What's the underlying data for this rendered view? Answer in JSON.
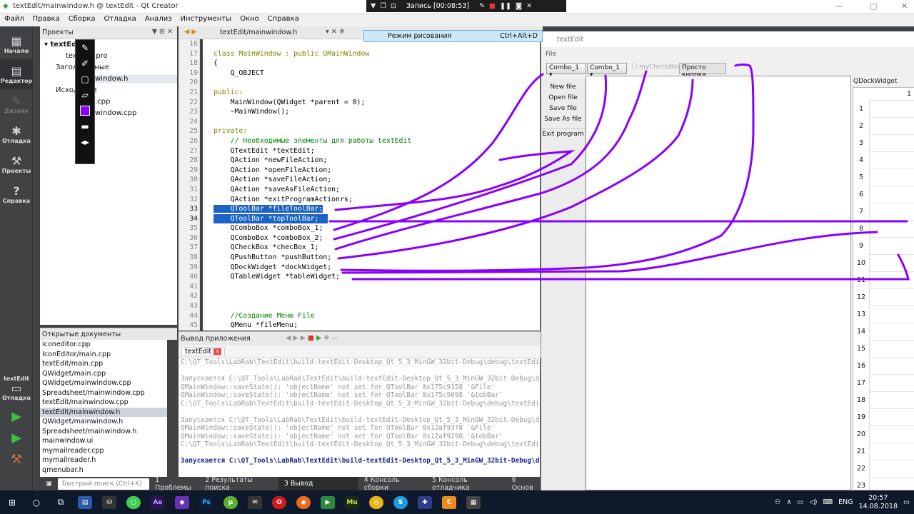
{
  "window": {
    "title": "textEdit/mainwindow.h @ textEdit - Qt Creator"
  },
  "menu": [
    "Файл",
    "Правка",
    "Сборка",
    "Отладка",
    "Анализ",
    "Инструменты",
    "Окно",
    "Справка"
  ],
  "recorder": {
    "label": "Запись [00:08:53]"
  },
  "modes": [
    {
      "label": "Начало",
      "icon": "grid-icon"
    },
    {
      "label": "Редактор",
      "icon": "editor-icon"
    },
    {
      "label": "Дизайн",
      "icon": "pen-icon"
    },
    {
      "label": "Отладка",
      "icon": "bug-icon"
    },
    {
      "label": "Проекты",
      "icon": "wrench-icon"
    },
    {
      "label": "Справка",
      "icon": "help-icon"
    }
  ],
  "target": {
    "label": "textEdit",
    "sub": "Отладка"
  },
  "projects": {
    "header": "Проекты",
    "tree": [
      "textEdit",
      "textEdit.pro",
      "Заголовочные",
      "mainwindow.h",
      "Исходники",
      "main.cpp",
      "mainwindow.cpp"
    ]
  },
  "drawing_tooltip": {
    "label": "Режим рисования",
    "shortcut": "Ctrl+Alt+D"
  },
  "open_docs": {
    "header": "Открытые документы",
    "items": [
      "iconeditor.cpp",
      "IconEditor/main.cpp",
      "textEdit/main.cpp",
      "QWidget/main.cpp",
      "QWidget/mainwindow.cpp",
      "Spreadsheet/mainwindow.cpp",
      "textEdit/mainwindow.cpp",
      "textEdit/mainwindow.h",
      "QWidget/mainwindow.h",
      "Spreadsheet/mainwindow.h",
      "mainwindow.ui",
      "mymailreader.cpp",
      "mymailreader.h",
      "qmenubar.h"
    ],
    "selected": 7
  },
  "editor": {
    "tab": "textEdit/mainwindow.h",
    "lines": [
      "16",
      "17",
      "18",
      "19",
      "20",
      "21",
      "22",
      "23",
      "24",
      "25",
      "26",
      "27",
      "28",
      "29",
      "30",
      "31",
      "32",
      "33",
      "34",
      "35",
      "36",
      "37",
      "38",
      "39",
      "40",
      "41",
      "42",
      "43",
      "44",
      "45"
    ],
    "code": [
      "",
      "class MainWindow : public QMainWindow",
      "{",
      "    Q_OBJECT",
      "",
      "public:",
      "    MainWindow(QWidget *parent = 0);",
      "    ~MainWindow();",
      "",
      "private:",
      "    // Необходимые элементы для работы textEdit",
      "    QTextEdit *textEdit;",
      "    QAction *newFileAction;",
      "    QAction *openFileAction;",
      "    QAction *saveFileAction;",
      "    QAction *saveAsFileAction;",
      "    QAction *exitProgramActionrs;",
      "    QToolBar *fileToolBar;",
      "    QToolBar *topToolBar;",
      "    QComboBox *comboBox_1;",
      "    QComboBox *comboBox_2;",
      "    QCheckBox *checBox_1;",
      "    QPushButton *pushButton;",
      "    QDockWidget *dockWidget;",
      "    QTableWidget *tableWidget;",
      "",
      "",
      "",
      "    //Создание Меню File",
      "    QMenu *fileMenu;"
    ]
  },
  "output": {
    "header": "Вывод приложения",
    "tab": "textEdit",
    "lines": [
      {
        "t": "C:\\QT_Tools\\LabRab\\TextEdit\\build-textEdit-Desktop_Qt_5_3_MinGW_32bit-Debug\\debug\\textEdit",
        "c": "gray"
      },
      {
        "t": "",
        "c": ""
      },
      {
        "t": "Запускается C:\\QT_Tools\\LabRab\\TextEdit\\build-textEdit-Desktop_Qt_5_3_MinGW_32bit-Debug\\de",
        "c": "gray"
      },
      {
        "t": "QMainWindow::saveState(): 'objectName' not set for QToolBar 0x175c9158 '&File'",
        "c": "gray"
      },
      {
        "t": "QMainWindow::saveState(): 'objectName' not set for QToolBar 0x175c9098 '&tobBar'",
        "c": "gray"
      },
      {
        "t": "C:\\QT_Tools\\LabRab\\TextEdit\\build-textEdit-Desktop_Qt_5_3_MinGW_32bit-Debug\\debug\\textEdit",
        "c": "gray"
      },
      {
        "t": "",
        "c": ""
      },
      {
        "t": "Запускается C:\\QT_Tools\\LabRab\\TextEdit\\build-textEdit-Desktop_Qt_5_3_MinGW_32bit-Debug\\de",
        "c": "gray"
      },
      {
        "t": "QMainWindow::saveState(): 'objectName' not set for QToolBar 0x12af9378 '&File'",
        "c": "gray"
      },
      {
        "t": "QMainWindow::saveState(): 'objectName' not set for QToolBar 0x12af9298 '&tobBar'",
        "c": "gray"
      },
      {
        "t": "C:\\QT_Tools\\LabRab\\TextEdit\\build-textEdit-Desktop_Qt_5_3_MinGW_32bit-Debug\\debug\\textEdit",
        "c": "gray"
      },
      {
        "t": "",
        "c": ""
      },
      {
        "t": "Запускается C:\\QT_Tools\\LabRab\\TextEdit\\build-textEdit-Desktop_Qt_5_3_MinGW_32bit-Debug\\de",
        "c": "bl"
      }
    ]
  },
  "bottom_tabs": [
    "1 Проблемы",
    "2 Результаты поиска",
    "3 Вывод приложения",
    "4 Консоль сборки",
    "5 Консоль отладчика",
    "6 Основ"
  ],
  "locator": {
    "placeholder": "Быстрый поиск (Ctrl+K)"
  },
  "app": {
    "title": "textEdit",
    "menu": "File",
    "combo1": "Combo_1",
    "combo2": "Combo_1",
    "checkbox": "myCheckBox",
    "button": "Просто кнопка",
    "actions": [
      "New file",
      "Open file",
      "Save file",
      "Save As file",
      "Exit program"
    ],
    "dock": {
      "title": "QDockWidget",
      "col": "1",
      "rows": [
        "1",
        "2",
        "3",
        "4",
        "5",
        "6",
        "7",
        "8",
        "9",
        "10",
        "11",
        "12",
        "13",
        "14",
        "15",
        "16",
        "17",
        "18",
        "19",
        "20",
        "21",
        "22",
        "23"
      ]
    }
  },
  "taskbar": {
    "lang": "ENG",
    "time": "20:57",
    "date": "14.08.2018",
    "apps": [
      "Ae",
      "Ps",
      "Mu"
    ]
  },
  "colors": {
    "annotation": "#8a00ff",
    "selection": "#1b63c6"
  }
}
